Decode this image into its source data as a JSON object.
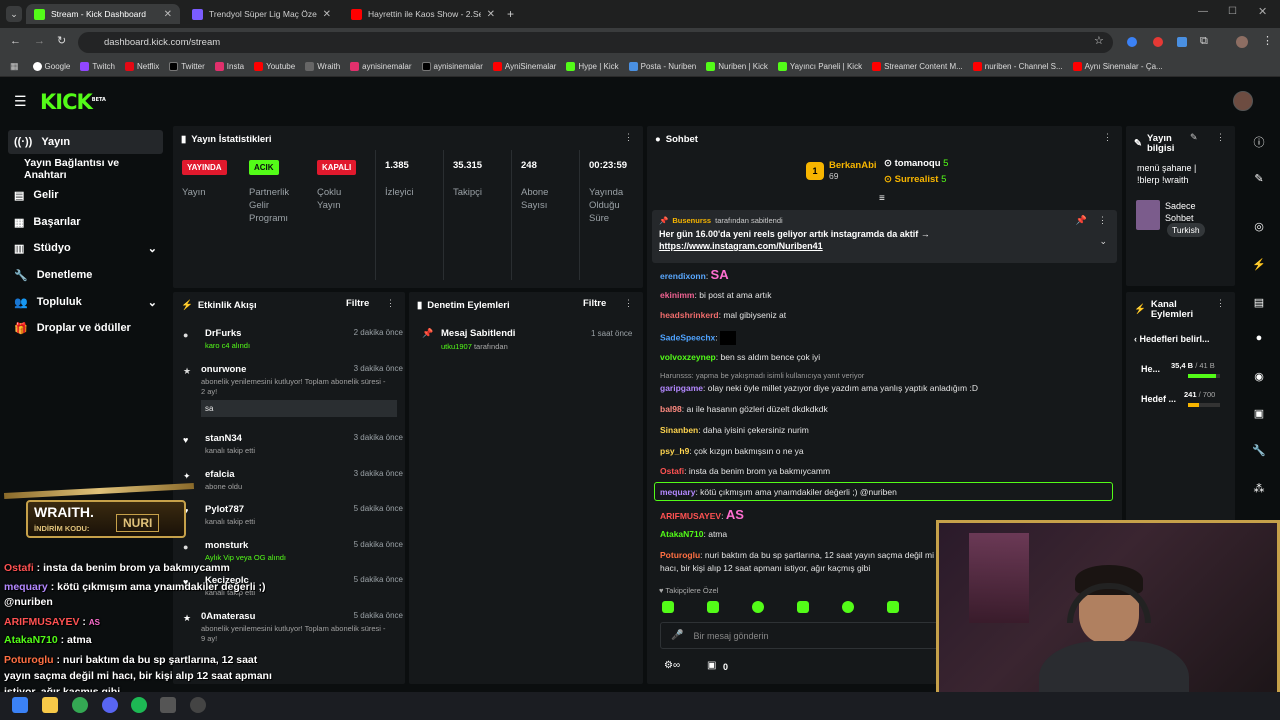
{
  "tabs": [
    {
      "label": "Stream - Kick Dashboard"
    },
    {
      "label": "Trendyol Süper Lig Maç Özetleri"
    },
    {
      "label": "Hayrettin ile Kaos Show - 2.Sez"
    }
  ],
  "url": "dashboard.kick.com/stream",
  "bookmarks": [
    "Google",
    "Twitch",
    "Netflix",
    "Twitter",
    "Insta",
    "Youtube",
    "Wraith",
    "aynisinemalar",
    "aynisinemalar",
    "AyniSinemalar",
    "Hype | Kick",
    "Posta - Nuriben",
    "Nuriben | Kick",
    "Yayıncı Paneli | Kick",
    "Streamer Content M...",
    "nuriben - Channel S...",
    "Aynı Sinemalar - Ça..."
  ],
  "logo": "KICK",
  "logo_beta": "BETA",
  "sidebar": {
    "items": [
      {
        "label": "Yayın"
      },
      {
        "label": "Yayın Bağlantısı ve Anahtarı"
      },
      {
        "label": "Gelir"
      },
      {
        "label": "Başarılar"
      },
      {
        "label": "Stüdyo"
      },
      {
        "label": "Denetleme"
      },
      {
        "label": "Topluluk"
      },
      {
        "label": "Droplar ve ödüller"
      }
    ]
  },
  "stats": {
    "title": "Yayın İstatistikleri",
    "badges": [
      {
        "text": "YAYINDA",
        "label": "Yayın"
      },
      {
        "text": "ACIK",
        "label": "Partnerlik Gelir Programı"
      },
      {
        "text": "KAPALI",
        "label": "Çoklu Yayın"
      }
    ],
    "values": [
      {
        "value": "1.385",
        "label": "İzleyici"
      },
      {
        "value": "35.315",
        "label": "Takipçi"
      },
      {
        "value": "248",
        "label": "Abone Sayısı"
      },
      {
        "value": "00:23:59",
        "label": "Yayında Olduğu Süre"
      }
    ]
  },
  "activity": {
    "title": "Etkinlik Akışı",
    "filter": "Filtre",
    "events": [
      {
        "name": "DrFurks",
        "sub": "karo c4 alındı",
        "time": "2 dakika önce"
      },
      {
        "name": "onurwone",
        "sub": "abonelik yenilemesini kutluyor! Toplam abonelik süresi - 2 ay!",
        "msg": "sa",
        "time": "3 dakika önce"
      },
      {
        "name": "stanN34",
        "sub": "kanalı takip etti",
        "time": "3 dakika önce"
      },
      {
        "name": "efalcia",
        "sub": "abone oldu",
        "time": "3 dakika önce"
      },
      {
        "name": "Pylot787",
        "sub": "kanalı takip etti",
        "time": "5 dakika önce"
      },
      {
        "name": "monsturk",
        "sub": "Aylık Vip veya OG alındı",
        "time": "5 dakika önce"
      },
      {
        "name": "Kecizeolc",
        "sub": "kanalı takip etti",
        "time": "5 dakika önce"
      },
      {
        "name": "0Amaterasu",
        "sub": "abonelik yenilemesini kutluyor! Toplam abonelik süresi - 9 ay!",
        "time": "5 dakika önce"
      }
    ]
  },
  "moderation": {
    "title": "Denetim Eylemleri",
    "filter": "Filtre",
    "item": {
      "name": "Mesaj Sabitlendi",
      "by": "utku1907",
      "by_suffix": "tarafından",
      "time": "1 saat önce"
    }
  },
  "chat": {
    "title": "Sohbet",
    "top": [
      {
        "name": "BerkanAbi",
        "count": "69",
        "rank": "1"
      },
      {
        "name": "tomanoqu",
        "count": "5"
      },
      {
        "name": "Surrealist",
        "count": "5"
      }
    ],
    "pinned": {
      "by": "Busenurss",
      "by_suffix": "tarafından sabitlendi",
      "text": "Her gün 16.00'da yeni reels geliyor artık instagramda da aktif →",
      "link": "https://www.instagram.com/Nuriben41"
    },
    "messages": [
      {
        "user": "erendixonn",
        "text": "SA",
        "color": "#5aa8ff"
      },
      {
        "user": "ekinimm",
        "text": "bi post at ama artık",
        "color": "#f06292"
      },
      {
        "user": "headshrinkerd",
        "text": "mal gibiyseniz at",
        "color": "#ef6c6c"
      },
      {
        "user": "SadeSpeechx",
        "text": "",
        "color": "#4fa3ff"
      },
      {
        "user": "volvoxzeynep",
        "text": "ben ss aldım bence çok iyi",
        "color": "#53fc18"
      },
      {
        "user": "garipgame",
        "text": "olay neki öyle millet yazıyor diye yazdım ama yanlış yaptık anladığım :D",
        "color": "#b388ff",
        "reply": "Harunsss: yapma be yakışmadı isimli kullanıcıya yanıt veriyor"
      },
      {
        "user": "bal98",
        "text": "aı ile hasanın gözleri düzelt dkdkdkdk",
        "color": "#ff8a80"
      },
      {
        "user": "Sinanben",
        "text": "daha iyisini çekersiniz nurim",
        "color": "#ffd54f"
      },
      {
        "user": "psy_h9",
        "text": "çok kızgın bakmışsın o ne ya",
        "color": "#ffd54f"
      },
      {
        "user": "Ostafi",
        "text": "insta da benim brom ya bakmıycamm",
        "color": "#ff5252"
      },
      {
        "user": "mequary",
        "text": "kötü çıkmışım ama ynaımdakiler değerli ;) @nuriben",
        "color": "#b388ff"
      },
      {
        "user": "ARIFMUSAYEV",
        "text": "AS",
        "color": "#ff5252"
      },
      {
        "user": "AtakaN710",
        "text": "atma",
        "color": "#53fc18"
      },
      {
        "user": "Poturoglu",
        "text": "nuri baktım da bu sp şartlarına, 12 saat yayın saçma değil mi hacı, bir kişi alıp 12 saat apmanı istiyor, ağır kaçmış gibi",
        "color": "#ff7043"
      }
    ],
    "followers_label": "Takipçilere Özel",
    "input_placeholder": "Bir mesaj gönderin",
    "points": "0"
  },
  "info": {
    "title": "Yayın bilgisi",
    "text": "menü şahane | !blerp !wraith",
    "category": "Sadece Sohbet",
    "tag": "Turkish"
  },
  "channel": {
    "title": "Kanal Eylemleri",
    "goals_title": "Hedefleri belirl...",
    "goals": [
      {
        "label": "He...",
        "value": "35,4 B",
        "max": "/ 41 B",
        "progress": 0.86
      },
      {
        "label": "Hedef ...",
        "value": "241",
        "max": "/ 700",
        "progress": 0.34
      }
    ]
  },
  "overlay": {
    "brand": "WRAITH.",
    "code_label": "İNDİRİM KODU:",
    "code": "NURI",
    "lines": [
      {
        "user": "Ostafi",
        "text": "insta da benim brom ya bakmıycamm",
        "color": "#ff5252"
      },
      {
        "user": "mequary",
        "text": "kötü çıkmışım ama ynaımdakiler değerli ;) @nuriben",
        "color": "#b388ff"
      },
      {
        "user": "ARIFMUSAYEV",
        "text": "AS",
        "color": "#ff5252"
      },
      {
        "user": "AtakaN710",
        "text": "atma",
        "color": "#53fc18"
      },
      {
        "user": "Poturoglu",
        "text": "nuri baktım da bu sp şartlarına, 12 saat yayın saçma değil mi hacı, bir kişi alıp 12 saat apmanı istiyor, ağır kaçmış gibi",
        "color": "#ff7043"
      }
    ]
  },
  "colors": {
    "kick": "#53fc18",
    "live": "#e1192d",
    "panel": "#15181a",
    "webcam_border": "#c6a14a"
  }
}
